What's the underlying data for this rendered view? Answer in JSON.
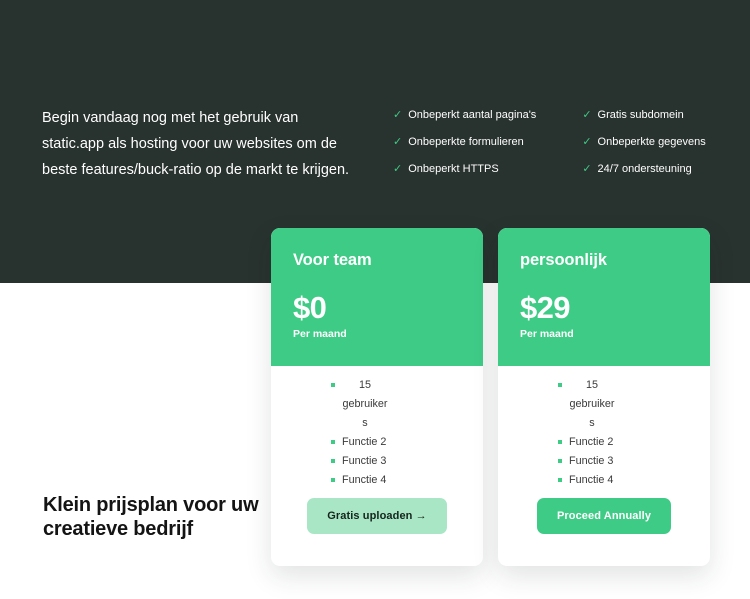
{
  "hero": {
    "intro": "Begin vandaag nog met het gebruik van static.app als hosting voor uw websites om de beste features/buck-ratio op de markt te krijgen.",
    "check_icon": "check-icon",
    "features_left": [
      "Onbeperkt aantal pagina's",
      "Onbeperkte formulieren",
      "Onbeperkt HTTPS"
    ],
    "features_right": [
      "Gratis subdomein",
      "Onbeperkte gegevens",
      "24/7 ondersteuning"
    ]
  },
  "bottom_heading": "Klein prijsplan voor uw creatieve bedrijf",
  "cards": [
    {
      "name": "Voor team",
      "price": "$0",
      "period": "Per maand",
      "features": [
        "15 gebruikers",
        "Functie 2",
        "Functie 3",
        "Functie 4"
      ],
      "feature_first_a": "15",
      "feature_first_b": "gebruiker",
      "feature_first_c": "s",
      "cta": "Gratis uploaden →"
    },
    {
      "name": "persoonlijk",
      "price": "$29",
      "period": "Per maand",
      "features": [
        "15 gebruikers",
        "Functie 2",
        "Functie 3",
        "Functie 4"
      ],
      "feature_first_a": "15",
      "feature_first_b": "gebruiker",
      "feature_first_c": "s",
      "cta": "Proceed Annually"
    }
  ],
  "colors": {
    "dark": "#28322e",
    "green": "#3ecb86",
    "green_light": "#a8e6c5",
    "text_dark": "#141414"
  }
}
